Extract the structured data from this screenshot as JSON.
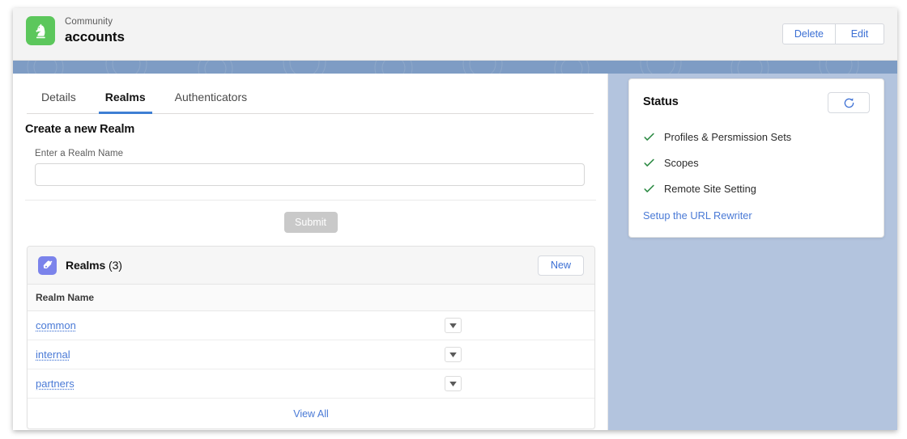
{
  "header": {
    "eyebrow": "Community",
    "title": "accounts",
    "app_icon": "chess-knight-icon",
    "actions": [
      {
        "label": "Delete",
        "name": "delete-button"
      },
      {
        "label": "Edit",
        "name": "edit-button"
      }
    ]
  },
  "tabs": [
    {
      "label": "Details",
      "active": false
    },
    {
      "label": "Realms",
      "active": true
    },
    {
      "label": "Authenticators",
      "active": false
    }
  ],
  "create_section": {
    "title": "Create a new Realm",
    "field_label": "Enter a Realm Name",
    "field_value": "",
    "field_placeholder": "",
    "submit_label": "Submit",
    "submit_disabled": true
  },
  "related_list": {
    "icon": "realm-tag-icon",
    "title": "Realms",
    "count_label": "(3)",
    "new_label": "New",
    "columns": [
      "Realm Name"
    ],
    "rows": [
      {
        "name": "common",
        "menu_icon": "chevron-down-icon"
      },
      {
        "name": "internal",
        "menu_icon": "chevron-down-icon"
      },
      {
        "name": "partners",
        "menu_icon": "chevron-down-icon"
      }
    ],
    "view_all_label": "View All"
  },
  "status_panel": {
    "title": "Status",
    "refresh_icon": "refresh-icon",
    "items": [
      {
        "label": "Profiles & Persmission Sets",
        "state": "check"
      },
      {
        "label": "Scopes",
        "state": "check"
      },
      {
        "label": "Remote Site Setting",
        "state": "check"
      }
    ],
    "link_label": "Setup the URL Rewriter"
  },
  "colors": {
    "app_icon_green": "#5cc75c",
    "link_blue": "#4a7ad6",
    "active_tab_blue": "#3e7fd4",
    "check_green": "#2e8b45",
    "right_panel_blue": "#b3c4de",
    "banner_blue": "#7e9cc4",
    "related_icon_purple": "#7b83eb",
    "submit_grey": "#c9c9c9"
  }
}
